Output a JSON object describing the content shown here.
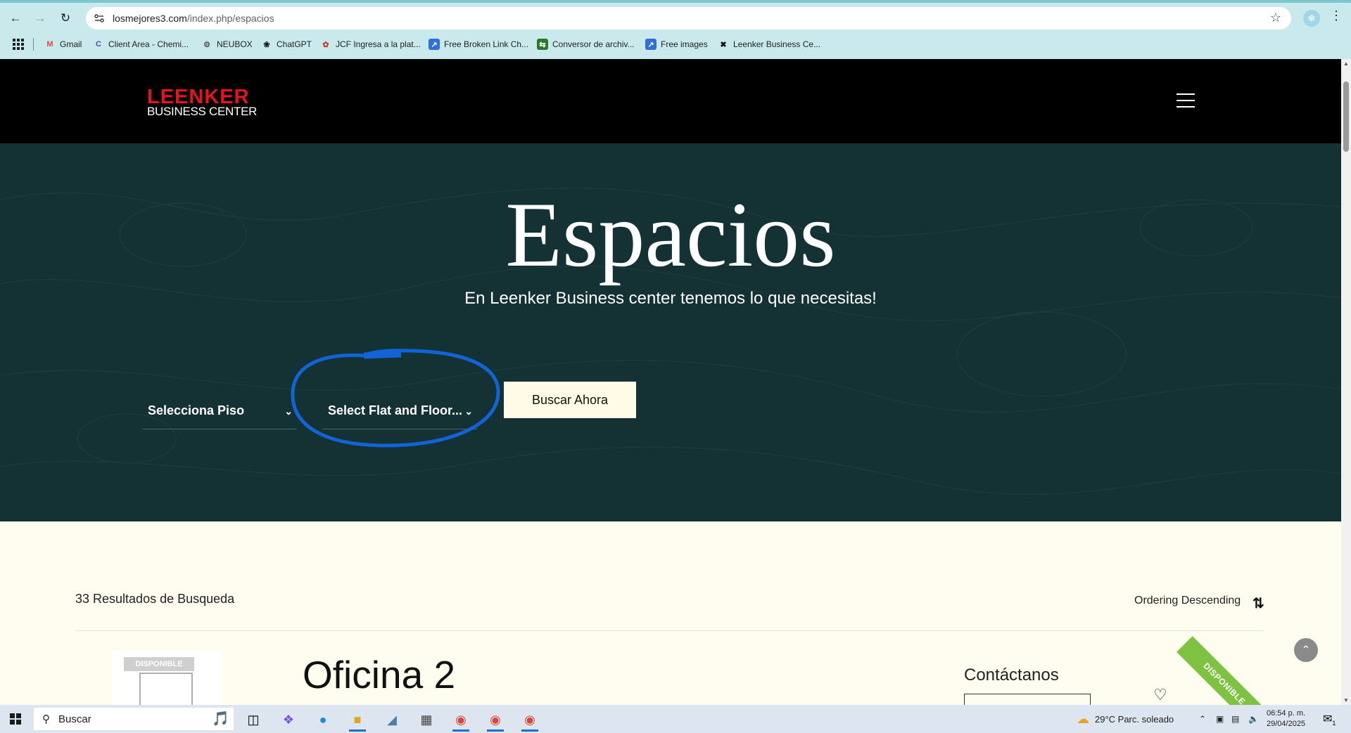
{
  "browser": {
    "url_host": "losmejores3.com",
    "url_path": "/index.php/espacios",
    "bookmarks": [
      {
        "label": "Gmail",
        "icon": "gmail-icon"
      },
      {
        "label": "Client Area - Chemi...",
        "icon": "client-area-icon"
      },
      {
        "label": "NEUBOX",
        "icon": "neubox-icon"
      },
      {
        "label": "ChatGPT",
        "icon": "chatgpt-icon"
      },
      {
        "label": "JCF Ingresa a la plat...",
        "icon": "jcf-icon"
      },
      {
        "label": "Free Broken Link Ch...",
        "icon": "broken-link-icon"
      },
      {
        "label": "Conversor de archiv...",
        "icon": "converter-icon"
      },
      {
        "label": "Free images",
        "icon": "free-images-icon"
      },
      {
        "label": "Leenker Business Ce...",
        "icon": "joomla-icon"
      }
    ]
  },
  "site": {
    "logo_line1": "LEENKER",
    "logo_line2": "BUSINESS CENTER",
    "accent_color": "#e3141b",
    "hero_bg": "#143133"
  },
  "hero": {
    "title": "Espacios",
    "subtitle": "En Leenker Business center tenemos lo que necesitas!",
    "select_floor": "Selecciona Piso",
    "select_flat": "Select Flat and Floor...",
    "search_button": "Buscar Ahora"
  },
  "results": {
    "count_text": "33 Resultados de Busqueda",
    "ordering": "Ordering Descending",
    "first_item_badge": "DISPONIBLE",
    "first_item_title": "Oficina 2",
    "contact_title": "Contáctanos",
    "ribbon": "DISPONIBLE"
  },
  "taskbar": {
    "search_placeholder": "Buscar",
    "weather": "29°C  Parc. soleado",
    "time": "06:54 p. m.",
    "date": "29/04/2025",
    "notification_count": "1"
  }
}
